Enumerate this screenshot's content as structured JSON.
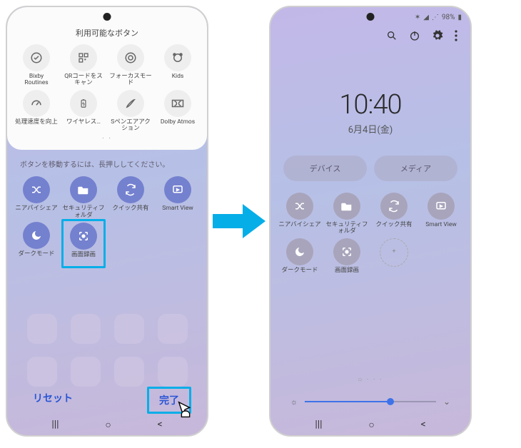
{
  "left": {
    "title": "利用可能なボタン",
    "hint": "ボタンを移動するには、長押ししてください。",
    "available": [
      {
        "label": "Bixby\nRoutines",
        "icon": "check"
      },
      {
        "label": "QRコードをスキャン",
        "icon": "qr"
      },
      {
        "label": "フォーカスモード",
        "icon": "target"
      },
      {
        "label": "Kids",
        "icon": "kids"
      },
      {
        "label": "処理速度を向上",
        "icon": "gauge"
      },
      {
        "label": "ワイヤレス…",
        "icon": "battery"
      },
      {
        "label": "Sペンエアアクション",
        "icon": "pen"
      },
      {
        "label": "Dolby Atmos",
        "icon": "dolby"
      }
    ],
    "active": [
      {
        "label": "ニアバイシェア",
        "icon": "shuffle"
      },
      {
        "label": "セキュリティフォルダ",
        "icon": "folder"
      },
      {
        "label": "クイック共有",
        "icon": "sync"
      },
      {
        "label": "Smart View",
        "icon": "sync2"
      },
      {
        "label": "ダークモード",
        "icon": "moon"
      },
      {
        "label": "画面録画",
        "icon": "record",
        "highlight": true
      }
    ],
    "buttons": {
      "reset": "リセット",
      "done": "完了"
    }
  },
  "right": {
    "status": {
      "battery": "98%"
    },
    "time": "10:40",
    "date": "6月4日(金)",
    "pills": [
      "デバイス",
      "メディア"
    ],
    "toggles": [
      {
        "label": "ニアバイシェア",
        "icon": "shuffle"
      },
      {
        "label": "セキュリティフォルダ",
        "icon": "folder"
      },
      {
        "label": "クイック共有",
        "icon": "sync"
      },
      {
        "label": "Smart View",
        "icon": "sync2"
      },
      {
        "label": "ダークモード",
        "icon": "moon"
      },
      {
        "label": "画面録画",
        "icon": "record"
      },
      {
        "label": "",
        "icon": "plus"
      }
    ]
  }
}
